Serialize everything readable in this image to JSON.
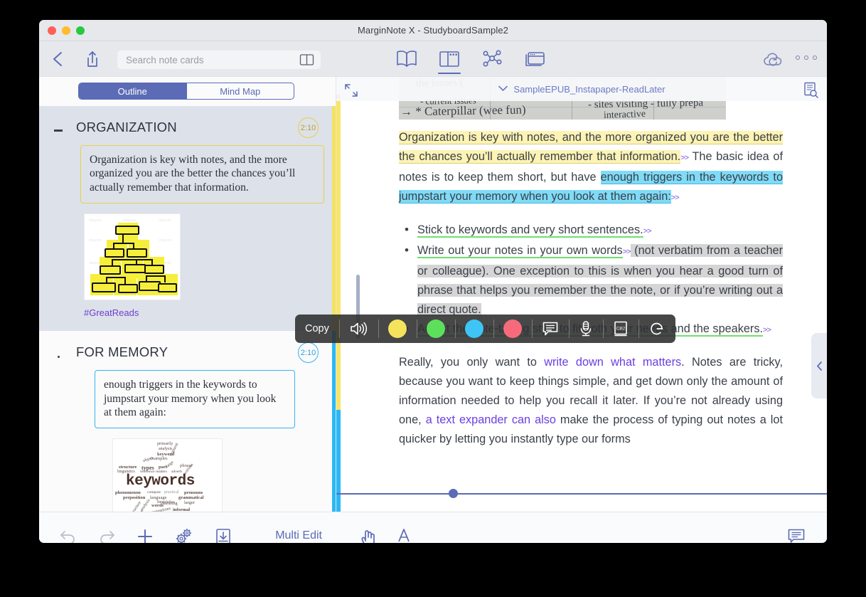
{
  "window": {
    "title": "MarginNote X - StudyboardSample2",
    "traffic_lights": [
      "close",
      "minimize",
      "zoom"
    ]
  },
  "toolbar": {
    "back_icon": "chevron-left-icon",
    "share_icon": "share-icon",
    "search": {
      "placeholder": "Search note cards",
      "value": ""
    },
    "search_book_icon": "book-split-icon",
    "modes": [
      {
        "name": "book-icon",
        "active": false
      },
      {
        "name": "study-panel-icon",
        "active": true
      },
      {
        "name": "mindmap-node-icon",
        "active": false
      },
      {
        "name": "cards-stack-icon",
        "active": false
      }
    ],
    "cloud_icon": "cloud-sync-icon",
    "overflow_icon": "more-dots-icon"
  },
  "left_panel": {
    "segments": [
      {
        "label": "Outline",
        "active": true
      },
      {
        "label": "Mind Map",
        "active": false
      }
    ],
    "cards": [
      {
        "title": "ORGANIZATION",
        "marker": "dash",
        "badge": "2:10",
        "badge_color": "#e8cf47",
        "selected": true,
        "excerpt": "Organization is key with notes, and the more organized you are the better the chances you’ll actually remember that information.",
        "excerpt_color": "#e5d34a",
        "thumbnail": "sticky-note-hierarchy-image",
        "tag": "#GreatReads",
        "edge_color": "#f5e35c"
      },
      {
        "title": "FOR MEMORY",
        "marker": "dot",
        "badge": "2:10",
        "badge_color": "#36b3ef",
        "selected": false,
        "excerpt": "enough triggers in the keywords to jumpstart your memory when you look at them again:",
        "excerpt_color": "#36b3ef",
        "thumbnail": "keywords-word-cloud-image",
        "tag": "",
        "edge_color": "#2bb8f5"
      }
    ]
  },
  "document": {
    "title": "SampleEPUB_Instapaper-ReadLater",
    "chevron_icon": "chevron-down-icon",
    "expand_icon": "expand-diagonal-icon",
    "search_icon": "document-search-icon",
    "handwriting_lines": [
      "the issues (",
      "- Current issues",
      "→ * Caterpillar (wee fun)",
      "- sites visiting - fully prepa",
      "interactive"
    ],
    "paragraph1": {
      "hl_yellow": "Organization is key with notes, and the more organized you are the better the chances you’ll actually remember that information.",
      "mid": " The basic idea of notes is to keep them short, but have ",
      "hl_blue": "enough triggers in the keywords to jumpstart your memory when you look at them again:",
      "marker": ">>"
    },
    "bullets": [
      {
        "green_text": "Stick to keywords and very short sentences.",
        "marker": ">>",
        "rest": ""
      },
      {
        "green_text": "Write out your notes in your own words",
        "marker": ">>",
        "rest": " (not verbatim from a teacher or colleague). One exception to this is when you hear a good turn of phrase that helps you remember the the note, or if you’re writing out a direct quote."
      },
      {
        "green_text": "Adjust the note-taking style to fit both your needs and the speakers.",
        "marker": ">>",
        "rest": ""
      }
    ],
    "paragraph2": {
      "a": "Really, you only want to ",
      "link1": "write down what matters",
      "b": ". Notes are tricky, because you want to keep things simple, and get down only the amount of information needed to help you recall it later. If you’re not already using one, ",
      "link2": "a text expander can also",
      "c": " make the process of typing out notes a lot quicker by letting you instantly type our forms"
    }
  },
  "popup_toolbar": {
    "copy_label": "Copy",
    "speak_icon": "speaker-icon",
    "colors": [
      {
        "name": "highlight-yellow",
        "hex": "#f5e35c"
      },
      {
        "name": "highlight-green",
        "hex": "#5ce05c"
      },
      {
        "name": "highlight-blue",
        "hex": "#3ec5f5"
      },
      {
        "name": "highlight-red",
        "hex": "#f76a7c"
      }
    ],
    "actions": [
      {
        "name": "comment-icon"
      },
      {
        "name": "microphone-icon"
      },
      {
        "name": "dictionary-icon",
        "label": "CB2"
      },
      {
        "name": "google-search-icon",
        "label": "G"
      }
    ]
  },
  "collapse_handle": {
    "icon": "chevron-left-icon"
  },
  "bottom_bar": {
    "left_icons": [
      {
        "name": "undo-icon"
      },
      {
        "name": "redo-icon"
      },
      {
        "name": "add-icon"
      },
      {
        "name": "settings-gears-icon"
      },
      {
        "name": "import-download-icon"
      }
    ],
    "multi_edit_label": "Multi Edit",
    "right_tools": [
      {
        "name": "hand-tool-icon",
        "active": true
      },
      {
        "name": "text-select-tool-icon",
        "active": false
      }
    ],
    "comment_icon": "comment-panel-icon"
  }
}
